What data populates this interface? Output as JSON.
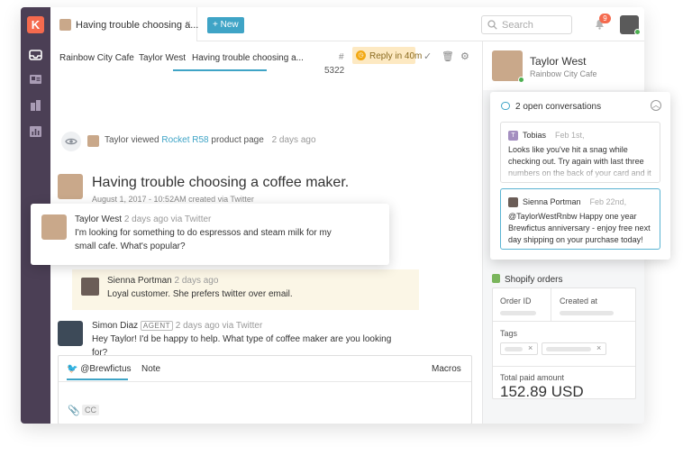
{
  "tab": {
    "title": "Having trouble choosing a...",
    "close": "×"
  },
  "new_button": "+ New",
  "search": {
    "placeholder": "Search"
  },
  "notifications": {
    "count": "9"
  },
  "subnav": {
    "items": [
      "Rainbow City Cafe",
      "Taylor West",
      "Having trouble choosing a..."
    ],
    "hash": "#",
    "number": "5322",
    "reply": "Reply in 40m"
  },
  "activity": {
    "actor": "Taylor viewed",
    "product": "Rocket R58",
    "suffix": "product page",
    "time": "2 days ago"
  },
  "conversation": {
    "title": "Having trouble choosing a coffee maker.",
    "meta": "August 1, 2017 - 10:52AM created via Twitter"
  },
  "message_taylor": {
    "name": "Taylor West",
    "time": "2 days ago via Twitter",
    "line1": "I'm looking for something to do espressos and steam milk for my",
    "line2": "small cafe. What's popular?"
  },
  "note": {
    "name": "Sienna Portman",
    "time": "2 days ago",
    "text": "Loyal customer. She prefers twitter over email."
  },
  "message_simon": {
    "name": "Simon Diaz",
    "badge": "AGENT",
    "time": "2 days ago via Twitter",
    "line1": "Hey Taylor! I'd be happy to help. What type of coffee maker are you looking",
    "line2": "for?"
  },
  "composer": {
    "handle": "@Brewfictus",
    "note_tab": "Note",
    "macros": "Macros",
    "cc": "CC"
  },
  "profile": {
    "name": "Taylor West",
    "org": "Rainbow City Cafe"
  },
  "open_conversations": {
    "title": "2 open conversations",
    "items": [
      {
        "initial": "T",
        "name": "Tobias",
        "date": "Feb 1st,",
        "text": "Looks like you've hit a snag while checking out. Try again with last three numbers on the back of your card and it"
      },
      {
        "name": "Sienna Portman",
        "date": "Feb 22nd,",
        "text": "@TaylorWestRnbw Happy one year Brewfictus anniversary - enjoy free next day shipping on your purchase today!"
      }
    ]
  },
  "shopify": {
    "title": "Shopify orders",
    "order_id": "Order ID",
    "created_at": "Created at",
    "tags": "Tags",
    "total_label": "Total paid amount",
    "total": "152.89 USD"
  },
  "colors": {
    "accent": "#3fa4c6",
    "sidebar": "#4b3f55",
    "logo": "#f56a4e",
    "note_bg": "#fbf6e6"
  }
}
